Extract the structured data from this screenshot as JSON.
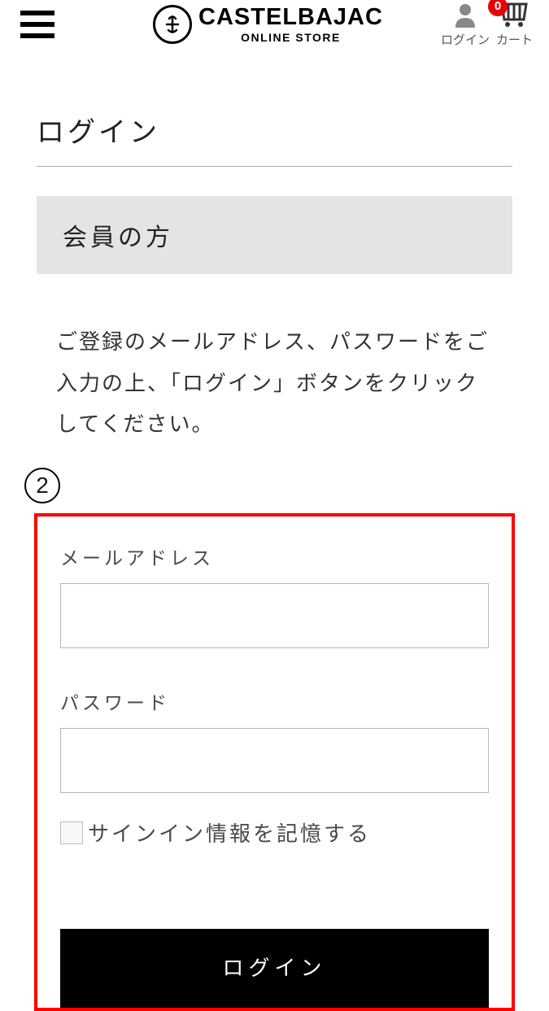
{
  "header": {
    "brand_name": "CASTELBAJAC",
    "brand_subtitle": "ONLINE STORE",
    "login_label": "ログイン",
    "cart_label": "カート",
    "cart_count": "0"
  },
  "page": {
    "title": "ログイン",
    "member_section_title": "会員の方",
    "instruction": "ご登録のメールアドレス、パスワードをご入力の上、「ログイン」ボタンをクリックしてください。",
    "step_number": "2"
  },
  "form": {
    "email_label": "メールアドレス",
    "email_value": "",
    "password_label": "パスワード",
    "password_value": "",
    "remember_label": "サインイン情報を記憶する",
    "login_button": "ログイン"
  }
}
